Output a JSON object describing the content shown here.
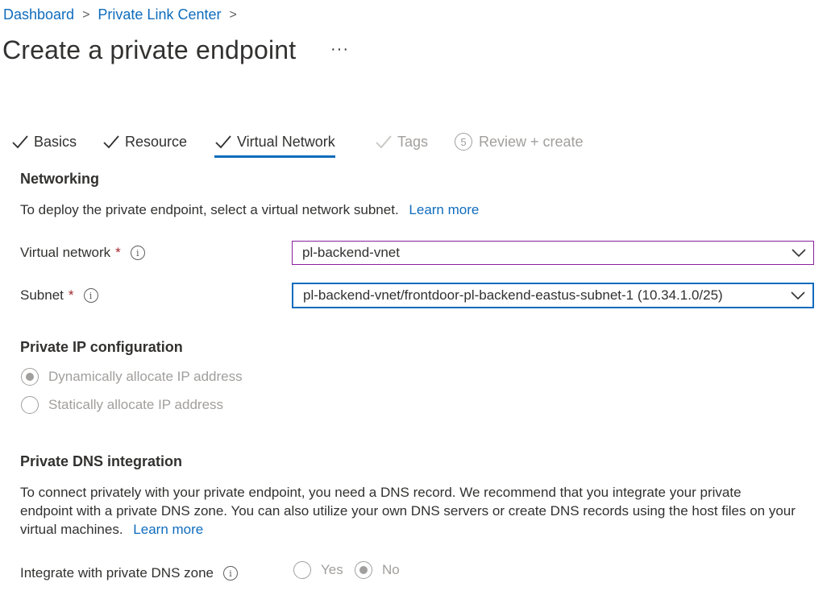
{
  "breadcrumb": {
    "items": [
      "Dashboard",
      "Private Link Center"
    ]
  },
  "page": {
    "title": "Create a private endpoint",
    "more": "···"
  },
  "tabs": [
    {
      "label": "Basics",
      "state": "done"
    },
    {
      "label": "Resource",
      "state": "done"
    },
    {
      "label": "Virtual Network",
      "state": "active"
    },
    {
      "label": "Tags",
      "state": "disabled"
    },
    {
      "step": "5",
      "label": "Review + create",
      "state": "disabled"
    }
  ],
  "networking": {
    "title": "Networking",
    "description": "To deploy the private endpoint, select a virtual network subnet.",
    "learn_more": "Learn more",
    "vnet_label": "Virtual network",
    "vnet_value": "pl-backend-vnet",
    "subnet_label": "Subnet",
    "subnet_value": "pl-backend-vnet/frontdoor-pl-backend-eastus-subnet-1 (10.34.1.0/25)",
    "required_mark": "*"
  },
  "private_ip": {
    "title": "Private IP configuration",
    "options": [
      {
        "label": "Dynamically allocate IP address",
        "selected": true
      },
      {
        "label": "Statically allocate IP address",
        "selected": false
      }
    ]
  },
  "dns": {
    "title": "Private DNS integration",
    "line1": "To connect privately with your private endpoint, you need a DNS record. We recommend that you integrate your private",
    "line2": "endpoint with a private DNS zone. You can also utilize your own DNS servers or create DNS records using the host files on your",
    "line3": "virtual machines.",
    "learn_more": "Learn more",
    "integrate_label": "Integrate with private DNS zone",
    "yes": "Yes",
    "no": "No",
    "selected": "No"
  },
  "colors": {
    "accent": "#0f6cbd",
    "required": "#a4262c",
    "disabled": "#a19f9d"
  }
}
